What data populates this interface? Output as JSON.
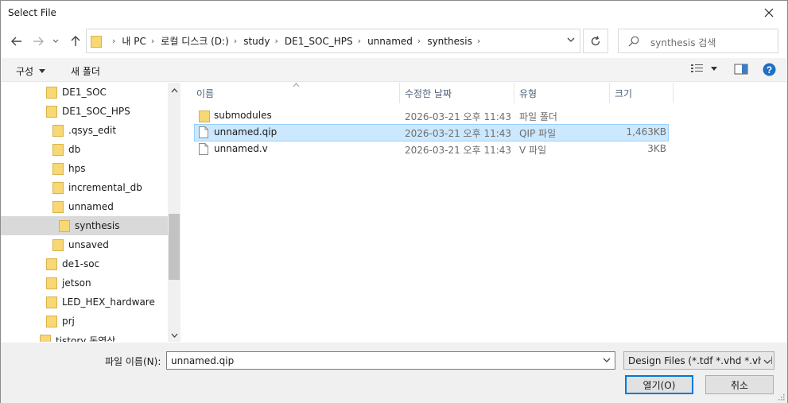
{
  "window": {
    "title": "Select File"
  },
  "address": {
    "crumbs": [
      "내 PC",
      "로컬 디스크 (D:)",
      "study",
      "DE1_SOC_HPS",
      "unnamed",
      "synthesis"
    ]
  },
  "search": {
    "placeholder": "synthesis 검색"
  },
  "toolbar": {
    "organize_label": "구성",
    "new_folder_label": "새 폴더"
  },
  "nav": {
    "items": [
      {
        "label": "DE1_SOC",
        "level": 1
      },
      {
        "label": "DE1_SOC_HPS",
        "level": 1
      },
      {
        "label": ".qsys_edit",
        "level": 2
      },
      {
        "label": "db",
        "level": 2
      },
      {
        "label": "hps",
        "level": 2
      },
      {
        "label": "incremental_db",
        "level": 2
      },
      {
        "label": "unnamed",
        "level": 2
      },
      {
        "label": "synthesis",
        "level": 3,
        "selected": true
      },
      {
        "label": "unsaved",
        "level": 2
      },
      {
        "label": "de1-soc",
        "level": 1
      },
      {
        "label": "jetson",
        "level": 1
      },
      {
        "label": "LED_HEX_hardware",
        "level": 1
      },
      {
        "label": "prj",
        "level": 1
      },
      {
        "label": "tistory 동영상",
        "level": 0
      }
    ]
  },
  "columns": {
    "name": "이름",
    "date": "수정한 날짜",
    "type": "유형",
    "size": "크기"
  },
  "files": [
    {
      "name": "submodules",
      "date": "2026-03-21 오후 11:43",
      "type": "파일 폴더",
      "size": "",
      "kind": "folder"
    },
    {
      "name": "unnamed.qip",
      "date": "2026-03-21 오후 11:43",
      "type": "QIP 파일",
      "size": "1,463KB",
      "kind": "file",
      "selected": true
    },
    {
      "name": "unnamed.v",
      "date": "2026-03-21 오후 11:43",
      "type": "V 파일",
      "size": "3KB",
      "kind": "file"
    }
  ],
  "bottom": {
    "filename_label": "파일 이름(N):",
    "filename_value": "unnamed.qip",
    "filter_value": "Design Files (*.tdf *.vhd *.vhdl",
    "open_label": "열기(O)",
    "cancel_label": "취소"
  },
  "icons": {
    "folder": "folder-icon",
    "file": "file-icon",
    "close": "close-icon",
    "back": "back-arrow-icon",
    "forward": "forward-arrow-icon",
    "up": "up-arrow-icon",
    "refresh": "refresh-icon",
    "search": "search-icon",
    "help": "help-icon"
  },
  "colors": {
    "folder": "#f8d775",
    "selection": "#cce8ff",
    "accent": "#0078d7"
  }
}
